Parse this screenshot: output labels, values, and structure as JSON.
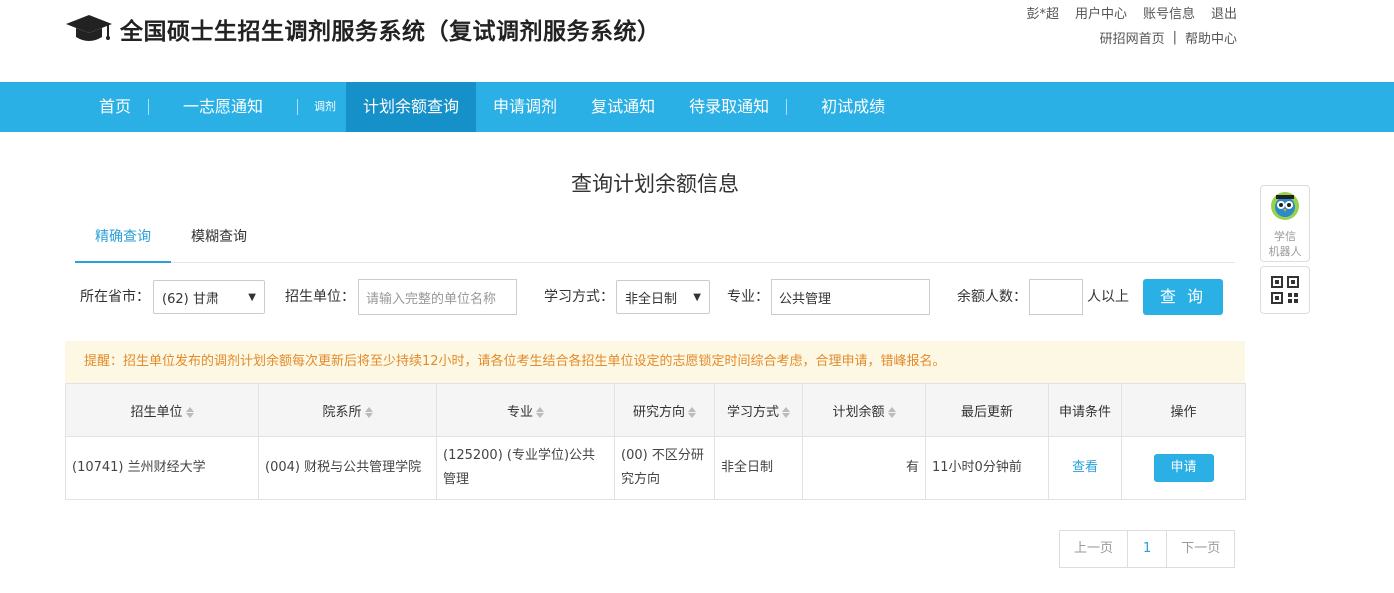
{
  "header": {
    "title": "全国硕士生招生调剂服务系统（复试调剂服务系统）",
    "user_name": "彭*超",
    "links_row1": [
      "用户中心",
      "账号信息",
      "退出"
    ],
    "links_row2": [
      "研招网首页",
      "帮助中心"
    ],
    "separator": "|"
  },
  "nav": {
    "items": [
      "首页",
      "一志愿通知",
      "调剂",
      "计划余额查询",
      "申请调剂",
      "复试通知",
      "待录取通知",
      "初试成绩"
    ],
    "active": "计划余额查询",
    "accent_color": "#2bb0e6",
    "active_color": "#1590c8"
  },
  "page_title": "查询计划余额信息",
  "tabs": [
    "精确查询",
    "模糊查询"
  ],
  "filters": {
    "province_label": "所在省市：",
    "province_value": "(62) 甘肃",
    "unit_label": "招生单位：",
    "unit_placeholder": "请输入完整的单位名称",
    "mode_label": "学习方式：",
    "mode_value": "非全日制",
    "major_label": "专业：",
    "major_value": "公共管理",
    "remain_label": "余额人数：",
    "remain_value": "",
    "remain_suffix": "人以上",
    "query_button": "查 询"
  },
  "notice": "提醒：招生单位发布的调剂计划余额每次更新后将至少持续12小时，请各位考生结合各招生单位设定的志愿锁定时间综合考虑，合理申请，错峰报名。",
  "table": {
    "headers": [
      "招生单位",
      "院系所",
      "专业",
      "研究方向",
      "学习方式",
      "计划余额",
      "最后更新",
      "申请条件",
      "操作"
    ],
    "rows": [
      {
        "unit": "(10741) 兰州财经大学",
        "dept": "(004) 财税与公共管理学院",
        "major": "(125200) (专业学位)公共管理",
        "direction": "(00) 不区分研究方向",
        "mode": "非全日制",
        "remain": "有",
        "updated": "11小时0分钟前",
        "condition": "查看",
        "action": "申请"
      }
    ]
  },
  "pager": {
    "prev": "上一页",
    "current": "1",
    "next": "下一页"
  },
  "side": {
    "robot_label_1": "学信",
    "robot_label_2": "机器人"
  }
}
